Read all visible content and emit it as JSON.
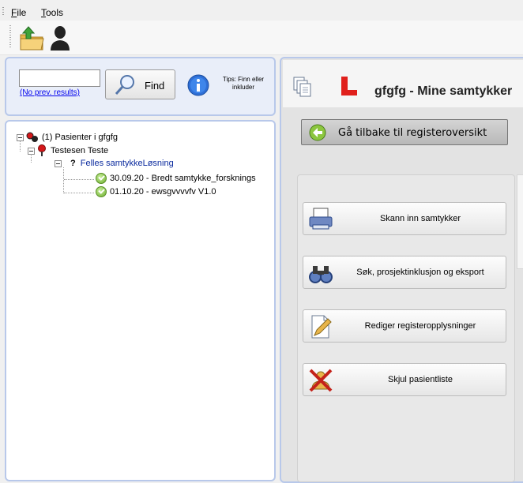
{
  "menu": {
    "file_u": "F",
    "file_rest": "ile",
    "tools_u": "T",
    "tools_rest": "ools"
  },
  "toolbar": {
    "icons": [
      "open-folder-icon",
      "user-silhouette-icon"
    ]
  },
  "search": {
    "value": "",
    "prev_results_link": "(No prev. results)",
    "find_label": "Find",
    "tips": "Tips: Finn eller inkluder"
  },
  "tree": {
    "root": "(1) Pasienter i gfgfg",
    "patient": "Testesen Teste",
    "group_prefix": "?",
    "group": "Felles samtykkeLøsning",
    "items": [
      "30.09.20 - Bredt samtykke_forsknings",
      "01.10.20 - ewsgvvvvfv V1.0"
    ]
  },
  "main": {
    "title": "gfgfg - Mine samtykker",
    "back_label": "Gå tilbake til registeroversikt",
    "actions": [
      {
        "label": "Skann inn samtykker",
        "icon": "printer-scanner-icon"
      },
      {
        "label": "Søk, prosjektinklusjon og eksport",
        "icon": "binoculars-icon"
      },
      {
        "label": "Rediger registeropplysninger",
        "icon": "edit-document-icon"
      },
      {
        "label": "Skjul pasientliste",
        "icon": "hide-users-icon"
      }
    ]
  },
  "colors": {
    "panel_border": "#b8c8ea",
    "link": "#0000ee",
    "brand_red": "#e0201c",
    "tree_group": "#0a2a9e"
  }
}
